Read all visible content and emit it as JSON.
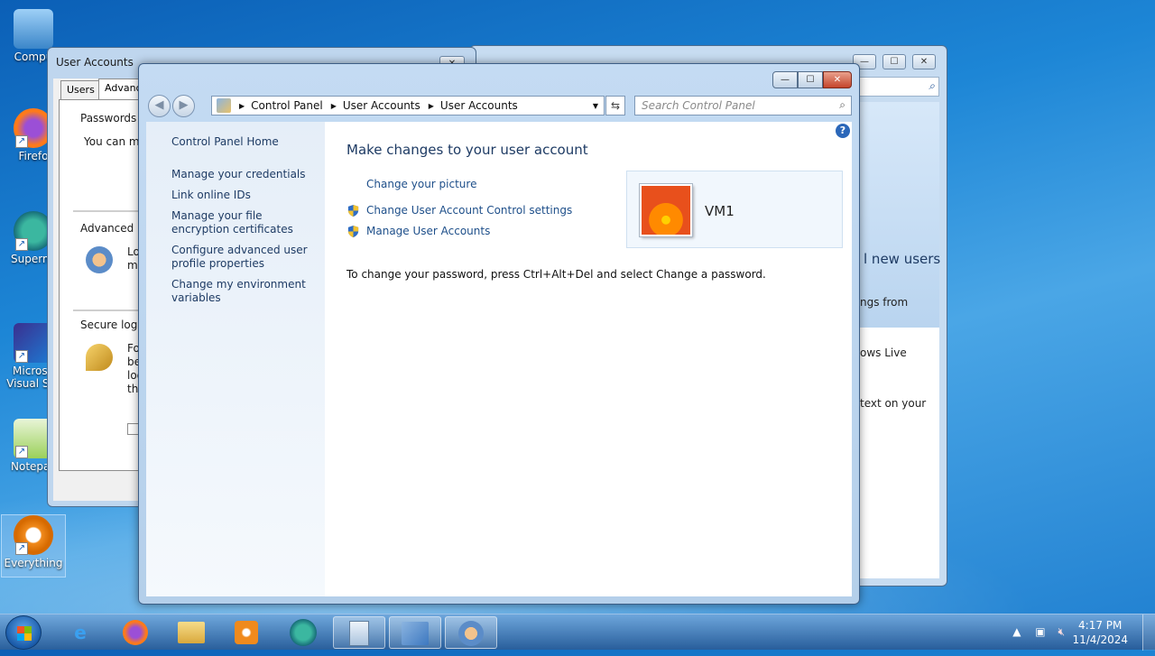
{
  "desktop": {
    "icons": [
      {
        "label": "Compu"
      },
      {
        "label": "Firefo"
      },
      {
        "label": "Supermi"
      },
      {
        "label": "Microso Visual Stu"
      },
      {
        "label": "Notepac"
      },
      {
        "label": "Everything"
      }
    ]
  },
  "back_right": {
    "new_users": "l new users",
    "line1": "ngs from",
    "line2": "ows Live",
    "line3": "text on your"
  },
  "back_left": {
    "title": "User Accounts",
    "tabs": [
      "Users",
      "Advance"
    ],
    "passwords_label": "Passwords",
    "you_can": "You can ma",
    "advanced_label": "Advanced u",
    "adv_text": "Lo ma",
    "secure_label": "Secure logo",
    "secure_text": [
      "Fo",
      "be",
      "log",
      "tha"
    ]
  },
  "window": {
    "caption": {
      "minimize": "—",
      "maximize": "☐",
      "close": "✕"
    },
    "breadcrumb": [
      "Control Panel",
      "User Accounts",
      "User Accounts"
    ],
    "search_placeholder": "Search Control Panel",
    "sidebar": {
      "home": "Control Panel Home",
      "links": [
        "Manage your credentials",
        "Link online IDs",
        "Manage your file encryption certificates",
        "Configure advanced user profile properties",
        "Change my environment variables"
      ]
    },
    "heading": "Make changes to your user account",
    "tasks": [
      "Change your picture",
      "Change User Account Control settings",
      "Manage User Accounts"
    ],
    "note": "To change your password, press Ctrl+Alt+Del and select Change a password.",
    "account_name": "VM1"
  },
  "taskbar": {
    "time": "4:17 PM",
    "date": "11/4/2024"
  }
}
